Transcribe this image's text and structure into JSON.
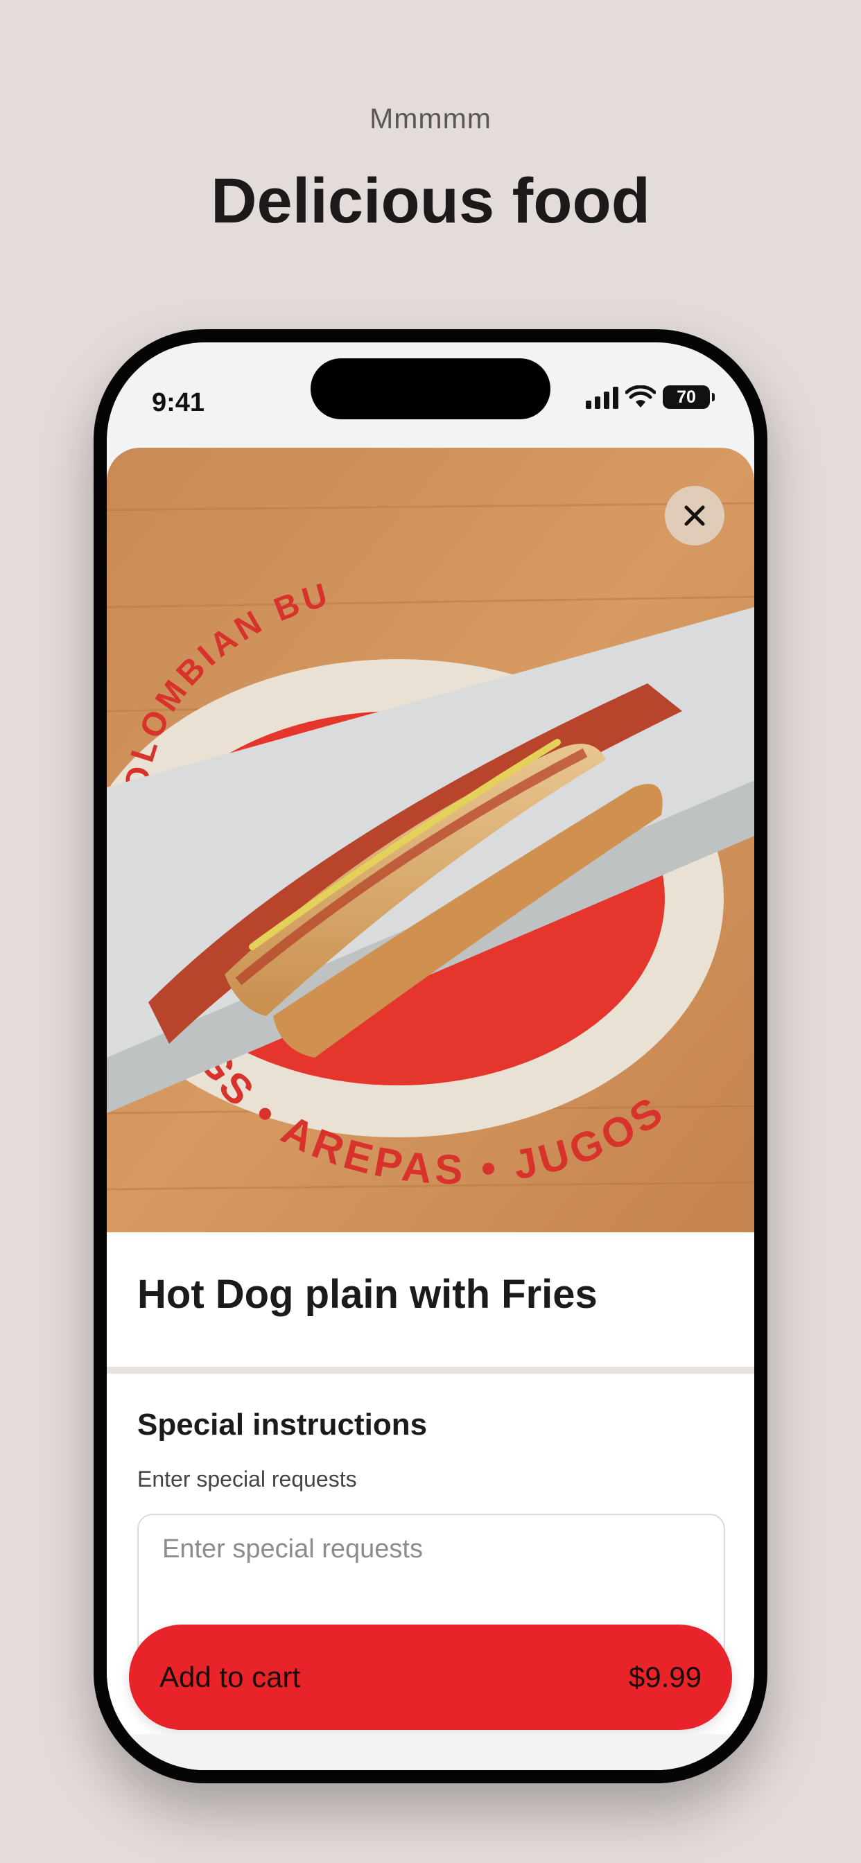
{
  "page": {
    "eyebrow": "Mmmmm",
    "headline": "Delicious food"
  },
  "status_bar": {
    "time": "9:41",
    "battery": "70"
  },
  "product": {
    "title": "Hot Dog plain with Fries",
    "image_text": {
      "top": "COLOMBIAN BU",
      "bottom": "GS • AREPAS • JUGOS"
    }
  },
  "instructions": {
    "title": "Special instructions",
    "label": "Enter special requests",
    "placeholder": "Enter special requests"
  },
  "cart": {
    "label": "Add to cart",
    "price": "$9.99"
  },
  "icons": {
    "close": "close-icon",
    "signal": "cellular-signal-icon",
    "wifi": "wifi-icon",
    "battery": "battery-icon"
  },
  "colors": {
    "accent": "#e8242a",
    "background": "#e4dcda"
  }
}
